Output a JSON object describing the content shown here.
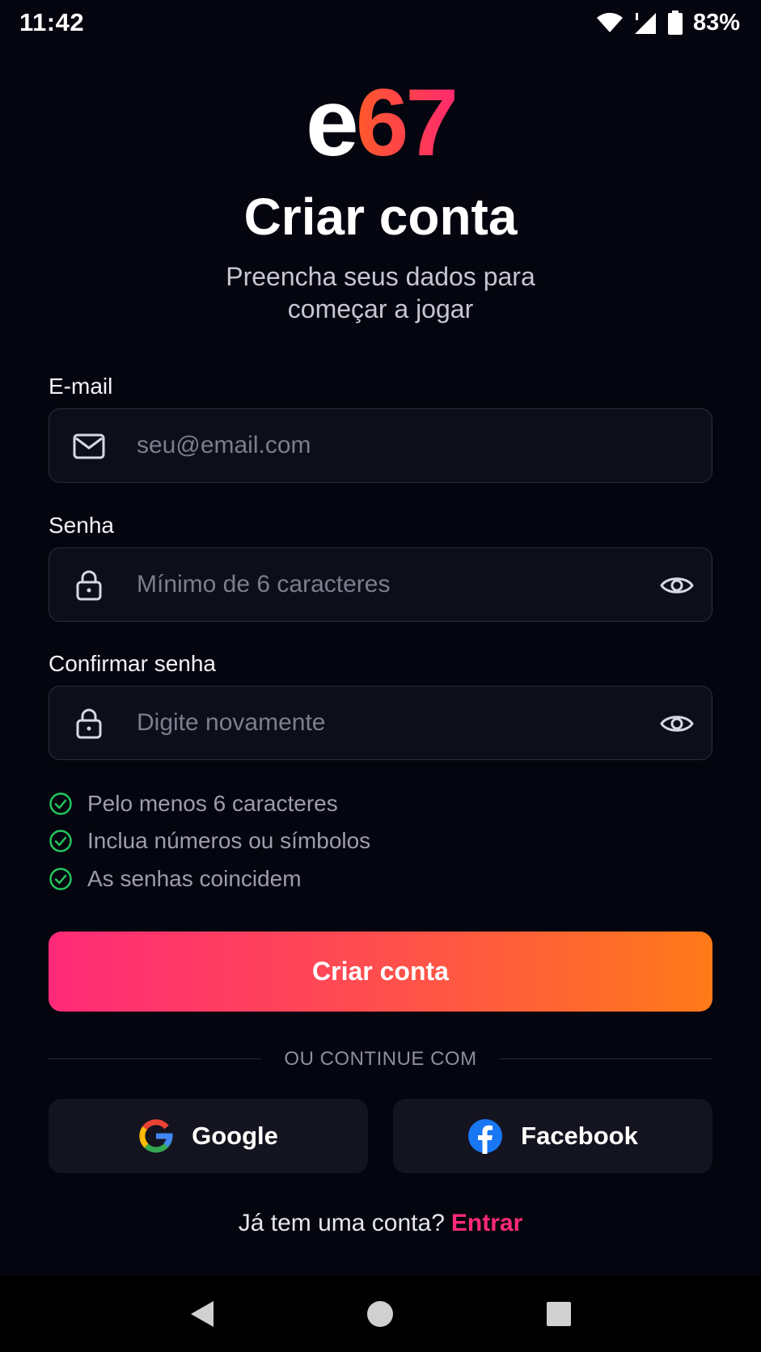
{
  "status_bar": {
    "time": "11:42",
    "battery_percent": "83%",
    "icons": [
      "wifi-icon",
      "signal-icon",
      "battery-icon"
    ]
  },
  "logo": {
    "letter": "e",
    "number": "67"
  },
  "header": {
    "title": "Criar conta",
    "subtitle": "Preencha seus dados para começar a jogar"
  },
  "form": {
    "email": {
      "label": "E-mail",
      "value": "",
      "placeholder": "seu@email.com",
      "icon": "mail-icon"
    },
    "password": {
      "label": "Senha",
      "value": "",
      "placeholder": "Mínimo de 6 caracteres",
      "icon": "lock-icon",
      "toggle_icon": "eye-icon"
    },
    "confirm_password": {
      "label": "Confirmar senha",
      "value": "",
      "placeholder": "Digite novamente",
      "icon": "lock-icon",
      "toggle_icon": "eye-icon"
    },
    "requirements": [
      {
        "text": "Pelo menos 6 caracteres",
        "icon": "check-circle-icon"
      },
      {
        "text": "Inclua números ou símbolos",
        "icon": "check-circle-icon"
      },
      {
        "text": "As senhas coincidem",
        "icon": "check-circle-icon"
      }
    ],
    "submit_label": "Criar conta"
  },
  "social": {
    "divider_text": "OU CONTINUE COM",
    "google_label": "Google",
    "facebook_label": "Facebook"
  },
  "footer": {
    "prompt": "Já tem uma conta?",
    "link_label": "Entrar"
  },
  "colors": {
    "background": "#05050f",
    "accent_pink": "#ff2a78",
    "accent_orange": "#ff7a18",
    "check_green": "#22c55e",
    "field_bg": "#0e0e1a",
    "social_bg": "#141420"
  }
}
